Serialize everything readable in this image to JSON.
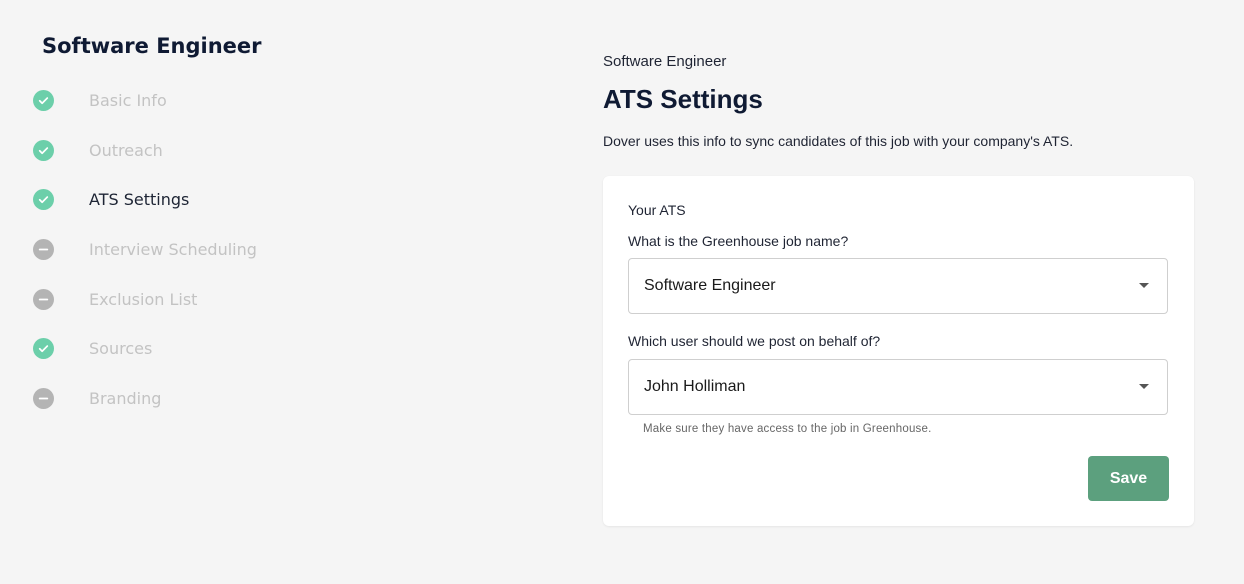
{
  "sidebar": {
    "title": "Software Engineer",
    "steps": [
      {
        "label": "Basic Info",
        "status": "done",
        "icon": "check-circle-icon"
      },
      {
        "label": "Outreach",
        "status": "done",
        "icon": "check-circle-icon"
      },
      {
        "label": "ATS Settings",
        "status": "done",
        "active": true,
        "icon": "check-circle-icon"
      },
      {
        "label": "Interview Scheduling",
        "status": "pending",
        "icon": "minus-circle-icon"
      },
      {
        "label": "Exclusion List",
        "status": "pending",
        "icon": "minus-circle-icon"
      },
      {
        "label": "Sources",
        "status": "done",
        "icon": "check-circle-icon"
      },
      {
        "label": "Branding",
        "status": "pending",
        "icon": "minus-circle-icon"
      }
    ]
  },
  "main": {
    "kicker": "Software Engineer",
    "title": "ATS Settings",
    "description": "Dover uses this info to sync candidates of this job with your company's ATS.",
    "card": {
      "heading": "Your ATS",
      "job_name_label": "What is the Greenhouse job name?",
      "job_name_value": "Software Engineer",
      "user_label": "Which user should we post on behalf of?",
      "user_value": "John Holliman",
      "user_helper": "Make sure they have access to the job in Greenhouse.",
      "save_label": "Save"
    }
  },
  "colors": {
    "done": "#6ccfaa",
    "pending": "#b4b4b4",
    "save_button": "#5ca07e",
    "background": "#f5f5f5"
  }
}
